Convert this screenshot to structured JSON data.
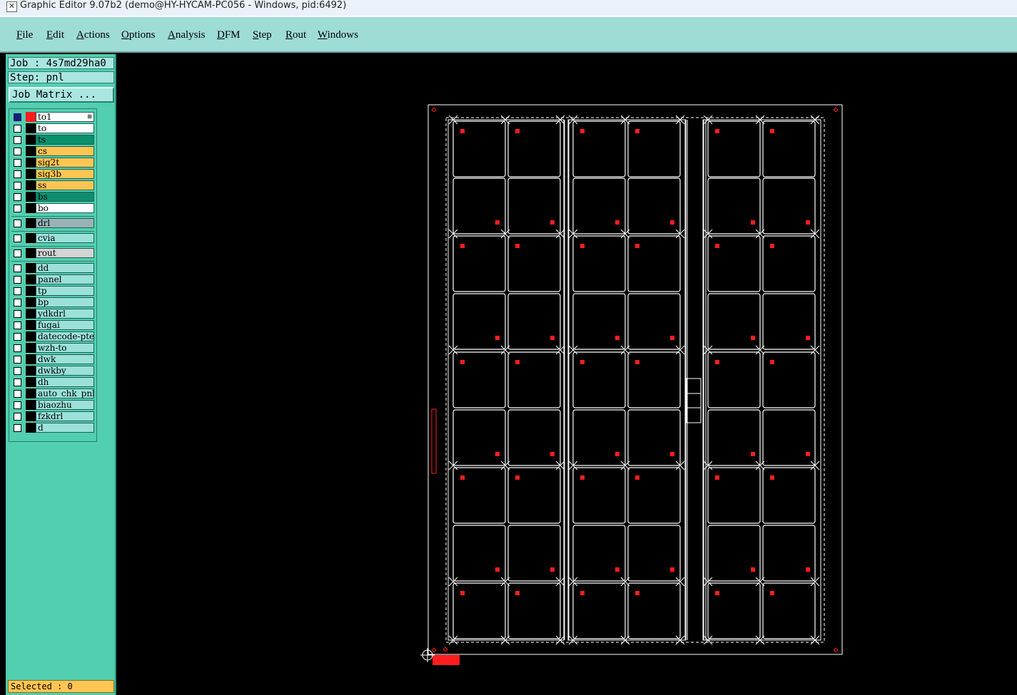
{
  "window": {
    "title": "Graphic Editor 9.07b2 (demo@HY-HYCAM-PC056 - Windows, pid:6492)",
    "icon": "close-x-icon"
  },
  "menu": [
    {
      "label": "File",
      "mnemonic": "F",
      "rest": "ile"
    },
    {
      "label": "Edit",
      "mnemonic": "E",
      "rest": "dit"
    },
    {
      "label": "Actions",
      "mnemonic": "A",
      "rest": "ctions"
    },
    {
      "label": "Options",
      "mnemonic": "O",
      "rest": "ptions"
    },
    {
      "label": "Analysis",
      "mnemonic": "A",
      "rest": "nalysis"
    },
    {
      "label": "DFM",
      "mnemonic": "D",
      "rest": "FM"
    },
    {
      "label": "Step",
      "mnemonic": "S",
      "rest": "tep"
    },
    {
      "label": "Rout",
      "mnemonic": "R",
      "rest": "out"
    },
    {
      "label": "Windows",
      "mnemonic": "W",
      "rest": "indows"
    }
  ],
  "panel": {
    "job": "Job : 4s7md29ha0",
    "step": "Step: pnl",
    "job_matrix_label": "Job Matrix ...",
    "selected": "Selected : 0"
  },
  "layers": [
    {
      "name": "to1",
      "group": 0,
      "bg": "white",
      "checked": true,
      "color": "#ff1e1e",
      "expand": "⊞"
    },
    {
      "name": "to",
      "group": 0,
      "bg": "white",
      "checked": false
    },
    {
      "name": "ts",
      "group": 0,
      "bg": "green",
      "checked": false
    },
    {
      "name": "cs",
      "group": 0,
      "bg": "orange",
      "checked": false
    },
    {
      "name": "sig2t",
      "group": 0,
      "bg": "orange",
      "checked": false
    },
    {
      "name": "sig3b",
      "group": 0,
      "bg": "orange",
      "checked": false
    },
    {
      "name": "ss",
      "group": 0,
      "bg": "orange",
      "checked": false
    },
    {
      "name": "bs",
      "group": 0,
      "bg": "green",
      "checked": false
    },
    {
      "name": "bo",
      "group": 0,
      "bg": "white",
      "checked": false
    },
    {
      "name": "drl",
      "group": 1,
      "bg": "slate",
      "checked": false
    },
    {
      "name": "cvia",
      "group": 2,
      "bg": "cyan",
      "checked": false
    },
    {
      "name": "rout",
      "group": 3,
      "bg": "grey",
      "checked": false
    },
    {
      "name": "dd",
      "group": 4,
      "bg": "cyan",
      "checked": false
    },
    {
      "name": "panel",
      "group": 4,
      "bg": "cyan",
      "checked": false
    },
    {
      "name": "tp",
      "group": 4,
      "bg": "cyan",
      "checked": false
    },
    {
      "name": "bp",
      "group": 4,
      "bg": "cyan",
      "checked": false
    },
    {
      "name": "ydkdrl",
      "group": 4,
      "bg": "cyan",
      "checked": false
    },
    {
      "name": "fugai",
      "group": 4,
      "bg": "cyan",
      "checked": false
    },
    {
      "name": "datecode-pte",
      "group": 4,
      "bg": "cyan",
      "checked": false
    },
    {
      "name": "wzh-to",
      "group": 4,
      "bg": "cyan",
      "checked": false
    },
    {
      "name": "dwk",
      "group": 4,
      "bg": "cyan",
      "checked": false
    },
    {
      "name": "dwkby",
      "group": 4,
      "bg": "cyan",
      "checked": false
    },
    {
      "name": "dh",
      "group": 4,
      "bg": "cyan",
      "checked": false
    },
    {
      "name": "auto_chk_pnl",
      "group": 4,
      "bg": "cyan",
      "checked": false
    },
    {
      "name": "biaozhu",
      "group": 4,
      "bg": "cyan",
      "checked": false
    },
    {
      "name": "fzkdrl",
      "group": 4,
      "bg": "cyan",
      "checked": false
    },
    {
      "name": "d",
      "group": 4,
      "bg": "cyan",
      "checked": false
    }
  ],
  "colors": {
    "menubar": "#9edcd6",
    "panel": "#52cfae",
    "canvas": "#000000",
    "outline": "#ffffff",
    "pad": "#ff1e1e"
  }
}
